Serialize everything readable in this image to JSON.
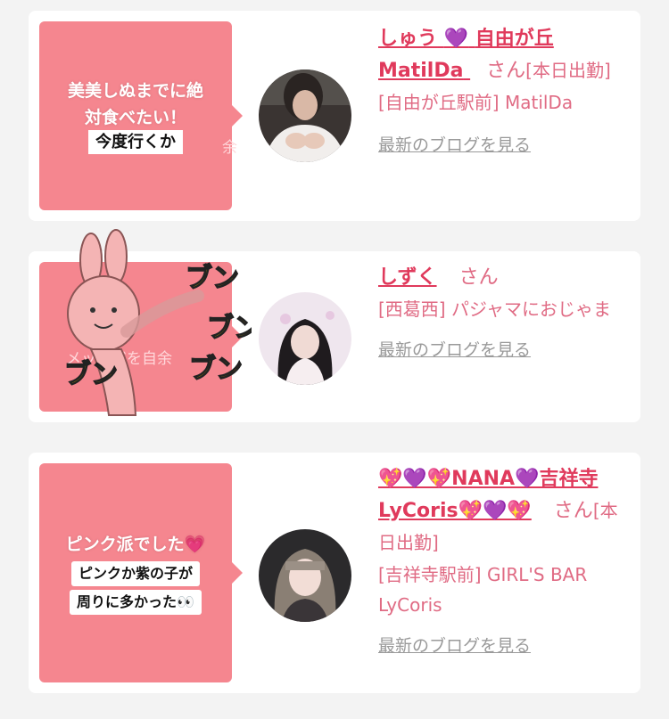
{
  "cards": [
    {
      "bubble": {
        "line1": "美美しぬまでに絶",
        "line2": "対食べたい！",
        "box": "今度行くか",
        "faded": "余"
      },
      "name_parts": {
        "a": "しゅう",
        "heart": "💜",
        "b": "自由が丘",
        "c": "MatilDa"
      },
      "san": "さん",
      "status": "[本日出勤]",
      "shop": "[自由が丘駅前] MatilDa",
      "blog_link": "最新のブログを見る"
    },
    {
      "bubble": {
        "faded": "メッ…ジを自余",
        "sticker_text1": "ブン",
        "sticker_text2": "ブン",
        "sticker_text3": "ブン",
        "sticker_text4": "ブン"
      },
      "name": "しずく",
      "san": "さん",
      "shop": "[西葛西] パジャマにおじゃま",
      "blog_link": "最新のブログを見る"
    },
    {
      "bubble": {
        "line1": "ピンク派でした💗",
        "box1": "ピンクか紫の子が",
        "box2": "周りに多かった👀"
      },
      "name": "💖💜💖NANA💜吉祥寺LyCoris💖💜💖",
      "san": "さん",
      "status": "[本日出勤]",
      "shop": "[吉祥寺駅前] GIRL'S BAR LyCoris",
      "blog_link": "最新のブログを見る"
    }
  ],
  "colors": {
    "accent": "#e03a5c",
    "bubble": "#f5868f",
    "link_gray": "#9a9a9a"
  },
  "icons": [
    "purple-heart-icon",
    "sparkling-heart-icon",
    "eyes-icon"
  ]
}
